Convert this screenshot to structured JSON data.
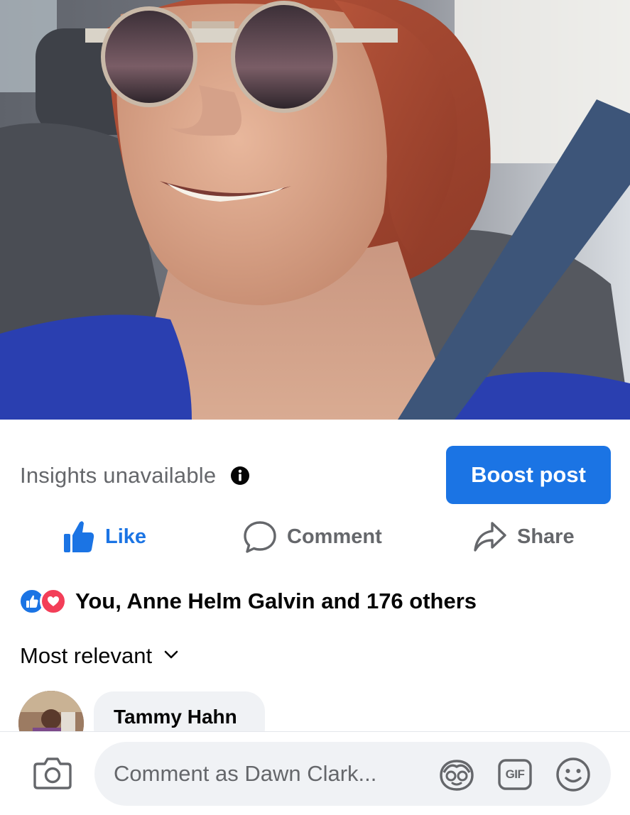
{
  "insights": {
    "label": "Insights unavailable",
    "info_icon": "info-icon"
  },
  "boost": {
    "label": "Boost post"
  },
  "actions": {
    "like": "Like",
    "comment": "Comment",
    "share": "Share"
  },
  "reactions": {
    "summary": "You, Anne Helm Galvin and 176 others",
    "types": [
      "like",
      "love"
    ]
  },
  "sort": {
    "label": "Most relevant",
    "icon": "chevron-down-icon"
  },
  "comments": [
    {
      "author": "Tammy Hahn"
    }
  ],
  "composer": {
    "placeholder": "Comment as Dawn Clark...",
    "gif_label": "GIF",
    "icons": [
      "camera-icon",
      "avatar-sticker-icon",
      "gif-icon",
      "emoji-icon"
    ]
  },
  "colors": {
    "accent": "#1b74e4",
    "secondary_text": "#65676b",
    "bubble_bg": "#f0f2f5",
    "love": "#f33e58"
  }
}
